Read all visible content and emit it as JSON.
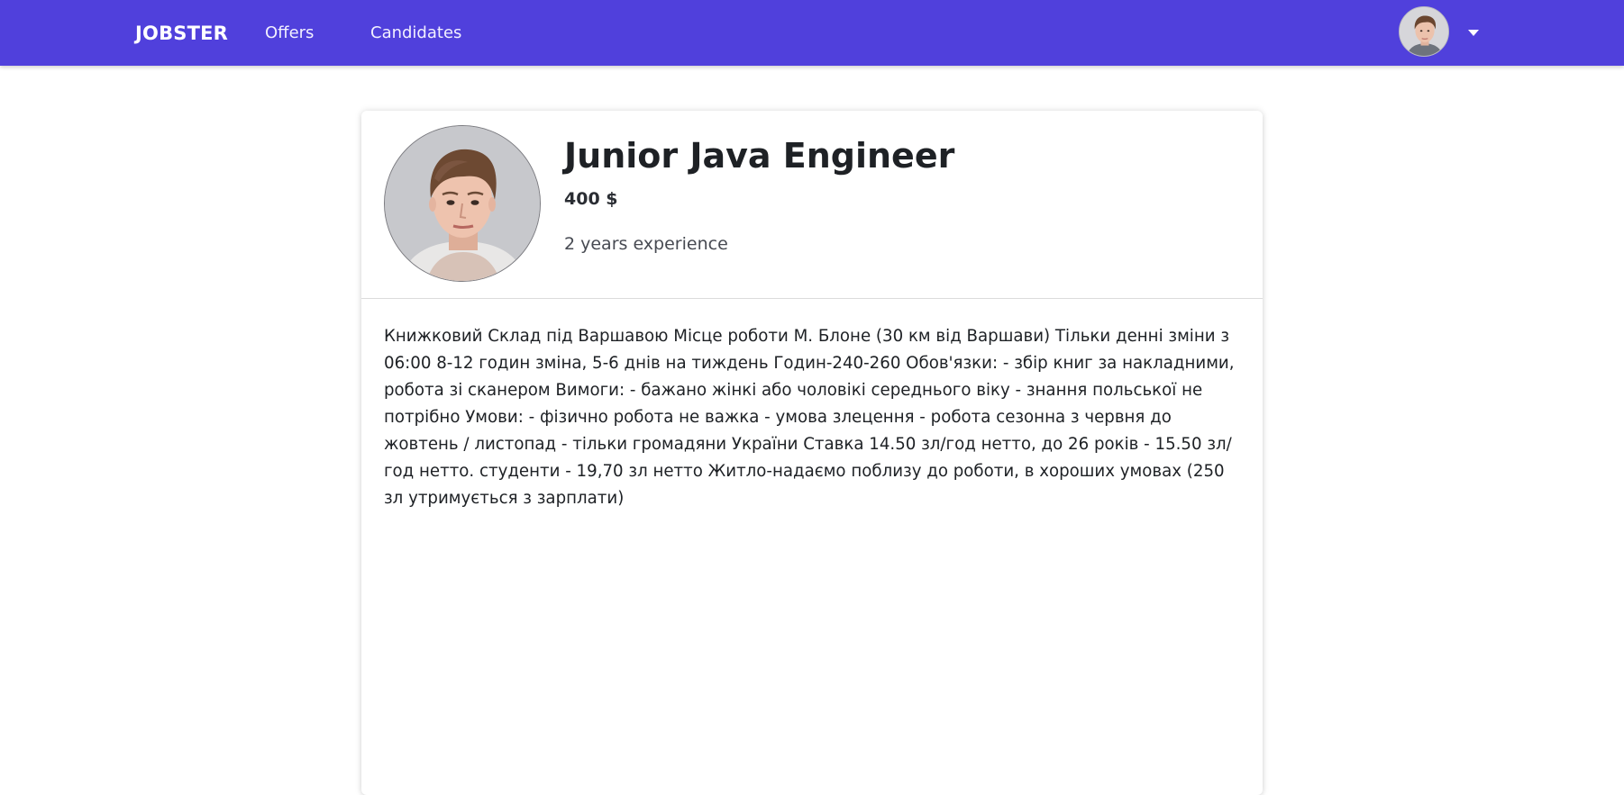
{
  "nav": {
    "brand": "JOBSTER",
    "links": [
      "Offers",
      "Candidates"
    ],
    "user_avatar_icon": "user-avatar-photo",
    "menu_caret_icon": "caret-down-icon",
    "background_color": "#5040dc"
  },
  "profile": {
    "avatar_icon": "candidate-photo",
    "title": "Junior Java Engineer",
    "salary": "400 $",
    "experience": "2 years experience",
    "description": "Книжковий Склад під Варшавою Місце роботи М. Блоне (30 км від Варшави) Тільки денні зміни з 06:00 8-12 годин зміна, 5-6 днів на тиждень Годин-240-260 Обов'язки: - збір книг за накладними, робота зі сканером Вимоги:  - бажано жінкі або чоловікі середнього віку  - знання польської не потрібно Умови: - фізично робота не важка - умова злецення - робота сезонна з червня до жовтень / листопад - тільки громадяни України Ставка 14.50 зл/год нетто, до 26 років - 15.50 зл/год нетто. студенти - 19,70 зл нетто Житло-надаємо поблизу до роботи, в хороших умовах (250 зл утримується з зарплати)"
  }
}
